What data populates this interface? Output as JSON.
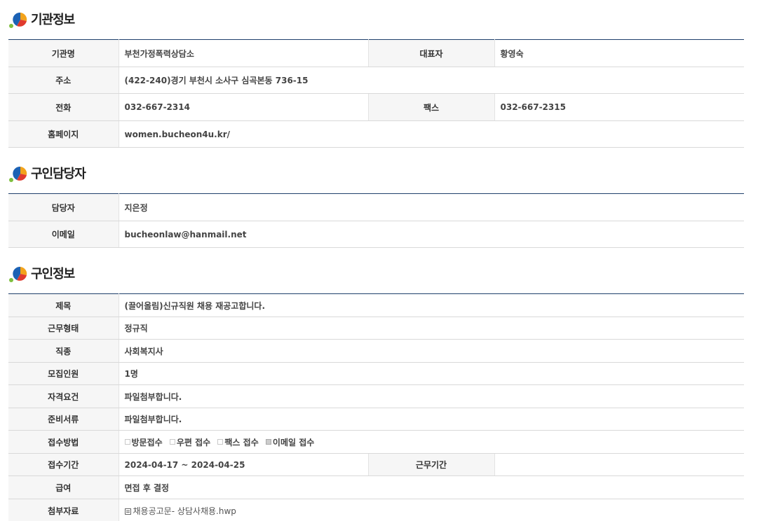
{
  "org_section": {
    "title": "기관정보",
    "rows": {
      "name_label": "기관명",
      "name": "부천가정폭력상담소",
      "rep_label": "대표자",
      "rep": "황영숙",
      "addr_label": "주소",
      "addr": "(422-240)경기 부천시 소사구 심곡본동 736-15",
      "phone_label": "전화",
      "phone": "032-667-2314",
      "fax_label": "팩스",
      "fax": "032-667-2315",
      "home_label": "홈페이지",
      "home": "women.bucheon4u.kr/"
    }
  },
  "contact_section": {
    "title": "구인담당자",
    "rows": {
      "person_label": "담당자",
      "person": "지은정",
      "email_label": "이메일",
      "email": "bucheonlaw@hanmail.net"
    }
  },
  "job_section": {
    "title": "구인정보",
    "rows": {
      "subject_label": "제목",
      "subject": "(끌어올림)신규직원 채용 재공고합니다.",
      "type_label": "근무형태",
      "type": "정규직",
      "job_label": "직종",
      "job": "사회복지사",
      "count_label": "모집인원",
      "count": "1명",
      "qual_label": "자격요건",
      "qual": "파일첨부합니다.",
      "docs_label": "준비서류",
      "docs": "파일첨부합니다.",
      "method_label": "접수방법",
      "methods": [
        "방문접수",
        "우편 접수",
        "팩스 접수",
        "이메일 접수"
      ],
      "method_checked": [
        false,
        false,
        false,
        true
      ],
      "period_label": "접수기간",
      "period": "2024-04-17 ~ 2024-04-25",
      "work_period_label": "근무기간",
      "work_period": "",
      "salary_label": "급여",
      "salary": "면접 후 결정",
      "attach_label": "첨부자료",
      "attach": "채용공고문- 상담사채용.hwp"
    }
  },
  "colors": {
    "header_border": "#1f3f6b",
    "th_bg": "#f6f6f6"
  }
}
